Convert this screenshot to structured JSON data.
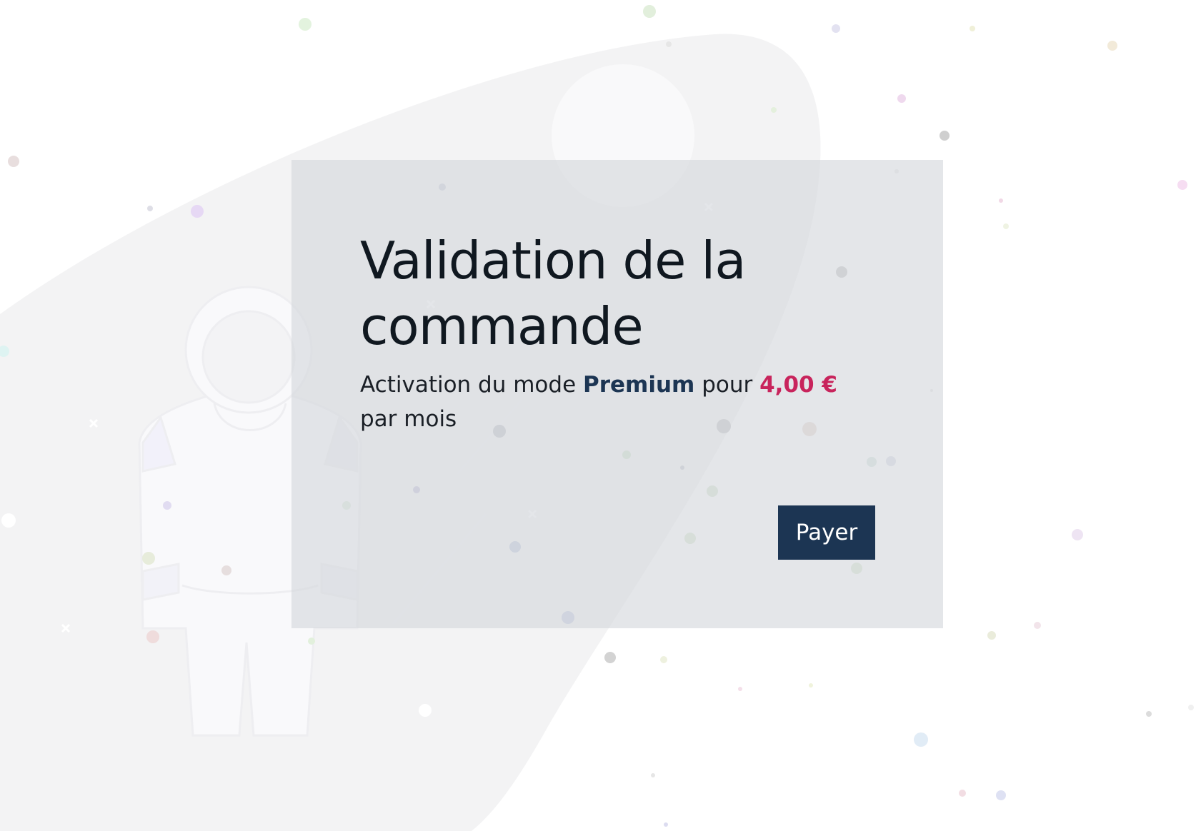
{
  "order": {
    "title": "Validation de la commande",
    "subtitle_prefix": "Activation du mode ",
    "plan_name": "Premium",
    "subtitle_middle": " pour ",
    "price": "4,00 €",
    "subtitle_suffix": " par mois",
    "pay_label": "Payer"
  },
  "colors": {
    "background": "#ffffff",
    "blob": "#f3f3f4",
    "card": "#dcdde0",
    "title_text": "#101820",
    "plan_accent": "#1c3553",
    "price_accent": "#c8245c",
    "button_bg": "#1c3553",
    "button_text": "#ffffff"
  },
  "decor": {
    "illustration": "astronaut-illustration",
    "planet": "moon-circle",
    "stars": "confetti-dots"
  }
}
